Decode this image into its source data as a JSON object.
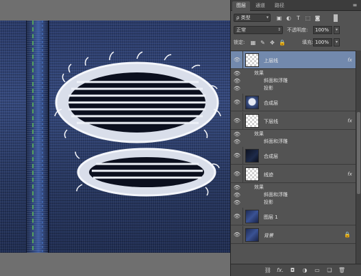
{
  "panel": {
    "tabs": [
      {
        "label": "图层"
      },
      {
        "label": "通道"
      },
      {
        "label": "路径"
      }
    ],
    "filter_kind": "ρ 类型",
    "blend_mode": "正常",
    "opacity_label": "不透明度:",
    "opacity_value": "100%",
    "lock_label": "锁定:",
    "fill_label": "填充:",
    "fill_value": "100%",
    "effects_label": "效果",
    "fx_label": "fx"
  },
  "layers": [
    {
      "name": "上层线",
      "thumb": "checker",
      "fx": true,
      "selected": true,
      "effects": [
        "斜面和浮雕",
        "投影"
      ]
    },
    {
      "name": "合成层",
      "thumb": "patch",
      "fx": false
    },
    {
      "name": "下层线",
      "thumb": "checker",
      "fx": true,
      "effects": [
        "斜面和浮雕"
      ]
    },
    {
      "name": "合成层",
      "thumb": "dark",
      "fx": false
    },
    {
      "name": "线迹",
      "thumb": "checker",
      "fx": true,
      "effects": [
        "斜面和浮雕",
        "投影"
      ]
    },
    {
      "name": "图层 1",
      "thumb": "denim",
      "fx": false
    },
    {
      "name": "背景",
      "thumb": "denim",
      "fx": false,
      "italic": true,
      "locked": true
    }
  ],
  "icons": {
    "eye": "eye-icon",
    "link": "link-icon",
    "fx": "fx-icon",
    "mask": "mask-icon",
    "adjustment": "adjustment-icon",
    "folder": "folder-icon",
    "new_layer": "new-layer-icon",
    "trash": "trash-icon",
    "lock": "lock-icon"
  },
  "colors": {
    "panel_bg": "#535353",
    "selected_row": "#7289ad",
    "denim": "#34487c"
  }
}
